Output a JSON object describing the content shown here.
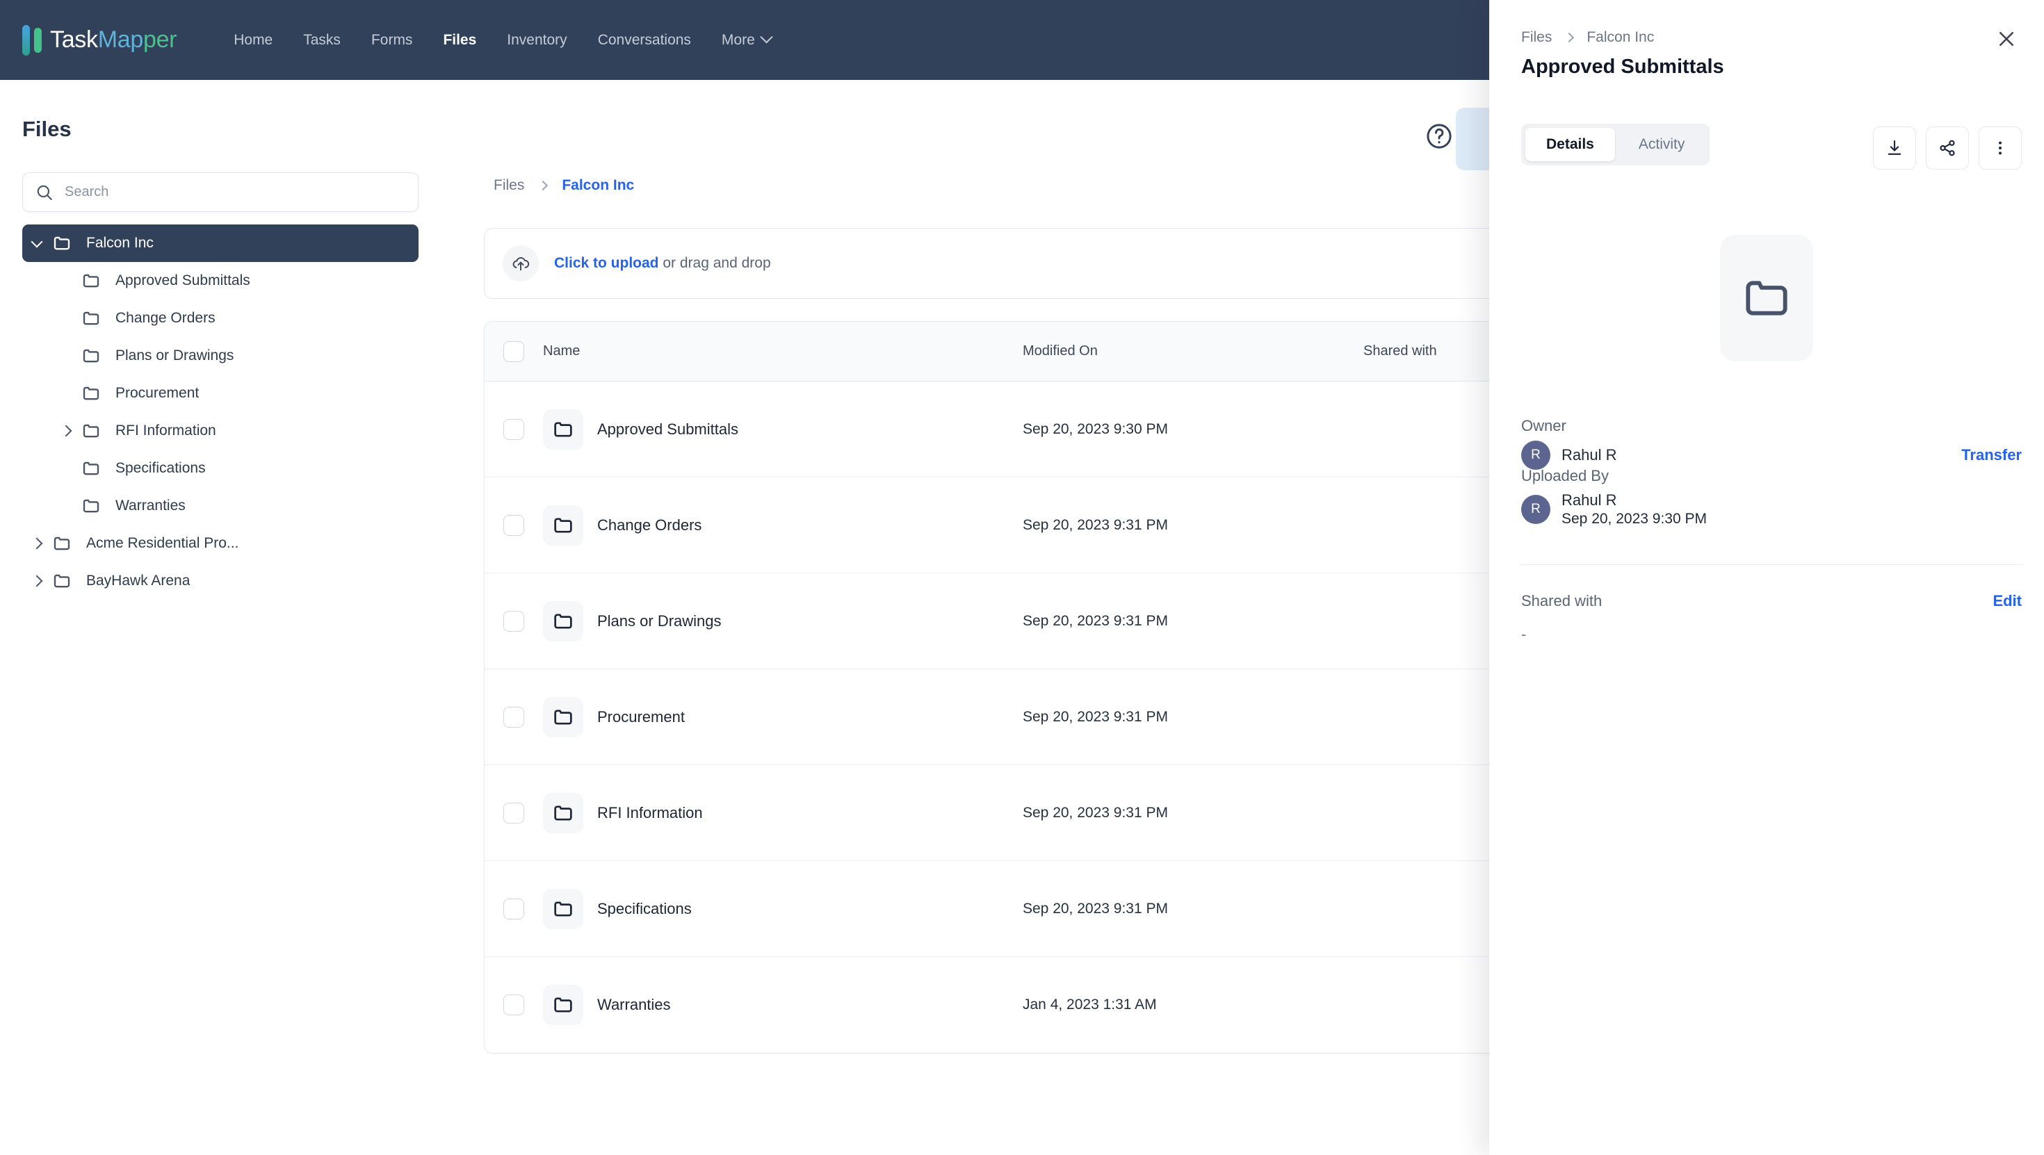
{
  "nav": {
    "brand": {
      "part1": "Task",
      "part2": "Map",
      "part3": "per"
    },
    "items": [
      {
        "label": "Home",
        "active": false
      },
      {
        "label": "Tasks",
        "active": false
      },
      {
        "label": "Forms",
        "active": false
      },
      {
        "label": "Files",
        "active": true
      },
      {
        "label": "Inventory",
        "active": false
      },
      {
        "label": "Conversations",
        "active": false
      },
      {
        "label": "More",
        "active": false,
        "has_caret": true
      }
    ]
  },
  "sidebar": {
    "title": "Files",
    "search": {
      "value": "",
      "placeholder": "Search"
    },
    "tree": [
      {
        "label": "Falcon Inc",
        "level": 0,
        "caret": "down",
        "active": true
      },
      {
        "label": "Approved Submittals",
        "level": 1,
        "caret": "none",
        "active": false
      },
      {
        "label": "Change Orders",
        "level": 1,
        "caret": "none",
        "active": false
      },
      {
        "label": "Plans or Drawings",
        "level": 1,
        "caret": "none",
        "active": false
      },
      {
        "label": "Procurement",
        "level": 1,
        "caret": "none",
        "active": false
      },
      {
        "label": "RFI Information",
        "level": 1,
        "caret": "right",
        "active": false
      },
      {
        "label": "Specifications",
        "level": 1,
        "caret": "none",
        "active": false
      },
      {
        "label": "Warranties",
        "level": 1,
        "caret": "none",
        "active": false
      },
      {
        "label": "Acme Residential Pro...",
        "level": 0,
        "caret": "right",
        "active": false
      },
      {
        "label": "BayHawk Arena",
        "level": 0,
        "caret": "right",
        "active": false
      }
    ]
  },
  "main": {
    "breadcrumb": {
      "root": "Files",
      "current": "Falcon Inc"
    },
    "dropzone": {
      "link": "Click to upload",
      "rest": " or drag and drop"
    },
    "table": {
      "columns": {
        "name": "Name",
        "modified": "Modified On",
        "shared": "Shared with"
      },
      "rows": [
        {
          "name": "Approved Submittals",
          "modified": "Sep 20, 2023 9:30 PM",
          "shared": ""
        },
        {
          "name": "Change Orders",
          "modified": "Sep 20, 2023 9:31 PM",
          "shared": ""
        },
        {
          "name": "Plans or Drawings",
          "modified": "Sep 20, 2023 9:31 PM",
          "shared": ""
        },
        {
          "name": "Procurement",
          "modified": "Sep 20, 2023 9:31 PM",
          "shared": ""
        },
        {
          "name": "RFI Information",
          "modified": "Sep 20, 2023 9:31 PM",
          "shared": ""
        },
        {
          "name": "Specifications",
          "modified": "Sep 20, 2023 9:31 PM",
          "shared": ""
        },
        {
          "name": "Warranties",
          "modified": "Jan 4, 2023 1:31 AM",
          "shared": ""
        }
      ]
    }
  },
  "panel": {
    "breadcrumb": {
      "root": "Files",
      "current": "Falcon Inc"
    },
    "title": "Approved Submittals",
    "tabs": [
      {
        "label": "Details",
        "active": true
      },
      {
        "label": "Activity",
        "active": false
      }
    ],
    "actions": [
      {
        "name": "download",
        "label": "Download"
      },
      {
        "name": "share",
        "label": "Share"
      },
      {
        "name": "more",
        "label": "More options"
      }
    ],
    "owner": {
      "label": "Owner",
      "initial": "R",
      "name": "Rahul R",
      "action": "Transfer"
    },
    "uploaded_by": {
      "label": "Uploaded By",
      "initial": "R",
      "name": "Rahul R",
      "date": "Sep 20, 2023 9:30 PM"
    },
    "shared_with": {
      "label": "Shared with",
      "action": "Edit",
      "value": "-"
    }
  },
  "colors": {
    "nav_bg": "#32415a",
    "accent_blue": "#2563eb",
    "text_dark": "#1e2636",
    "text_muted": "#6c7689",
    "brand_blue": "#5fb3d9",
    "brand_green": "#4fbf92"
  }
}
